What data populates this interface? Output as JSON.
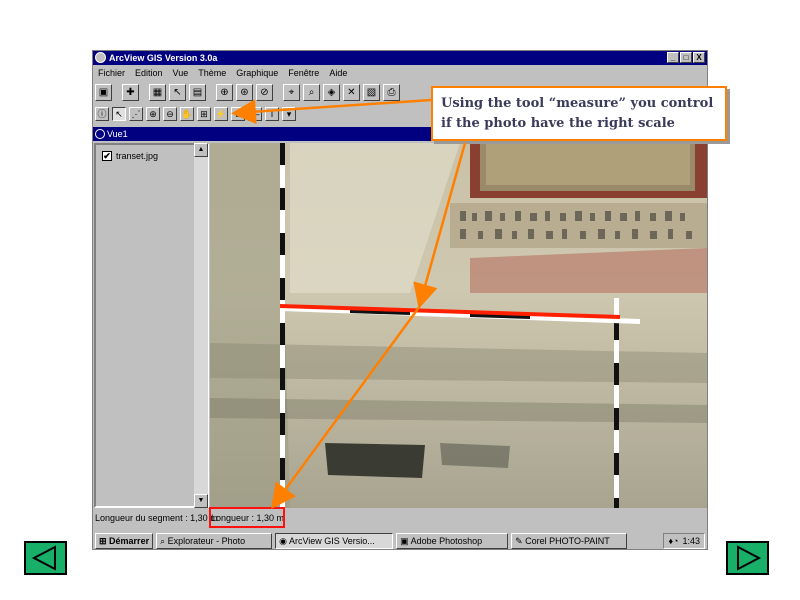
{
  "window": {
    "title": "ArcView GIS Version 3.0a",
    "controls": {
      "minimize": "_",
      "maximize": "□",
      "close": "X"
    }
  },
  "menu": [
    "Fichier",
    "Edition",
    "Vue",
    "Thème",
    "Graphique",
    "Fenêtre",
    "Aide"
  ],
  "toolbar_buttons": [
    "save",
    "add-theme",
    "table",
    "select",
    "properties",
    "zoom-in",
    "zoom-out",
    "identify",
    "query",
    "chart",
    "layout",
    "print",
    "help"
  ],
  "tool_buttons": [
    "identify",
    "pointer",
    "vertex",
    "zoom-in",
    "zoom-out",
    "pan",
    "measure",
    "hotlink",
    "label",
    "text",
    "draw"
  ],
  "view": {
    "title": "Vue1",
    "theme_name": "transet.jpg",
    "theme_checked": "✔"
  },
  "status": {
    "segment_length": "Longueur du segment : 1,30 m",
    "length": "Longueur : 1,30 m"
  },
  "taskbar": {
    "start": "Démarrer",
    "tasks": [
      "Explorateur - Photo",
      "ArcView GIS Versio...",
      "Adobe Photoshop",
      "Corel PHOTO-PAINT"
    ],
    "active_index": 1,
    "clock": "1:43"
  },
  "callout": {
    "text": "Using the tool “measure” you control if the photo have the right scale"
  },
  "navigation": {
    "prev_icon": "triangle-left-icon",
    "next_icon": "triangle-right-icon"
  },
  "colors": {
    "callout_border": "#ff8000",
    "arrow": "#ff8000",
    "measure_line": "#ff2000",
    "highlight": "#ff1010",
    "nav_button": "#18b068",
    "titlebar": "#000080"
  }
}
